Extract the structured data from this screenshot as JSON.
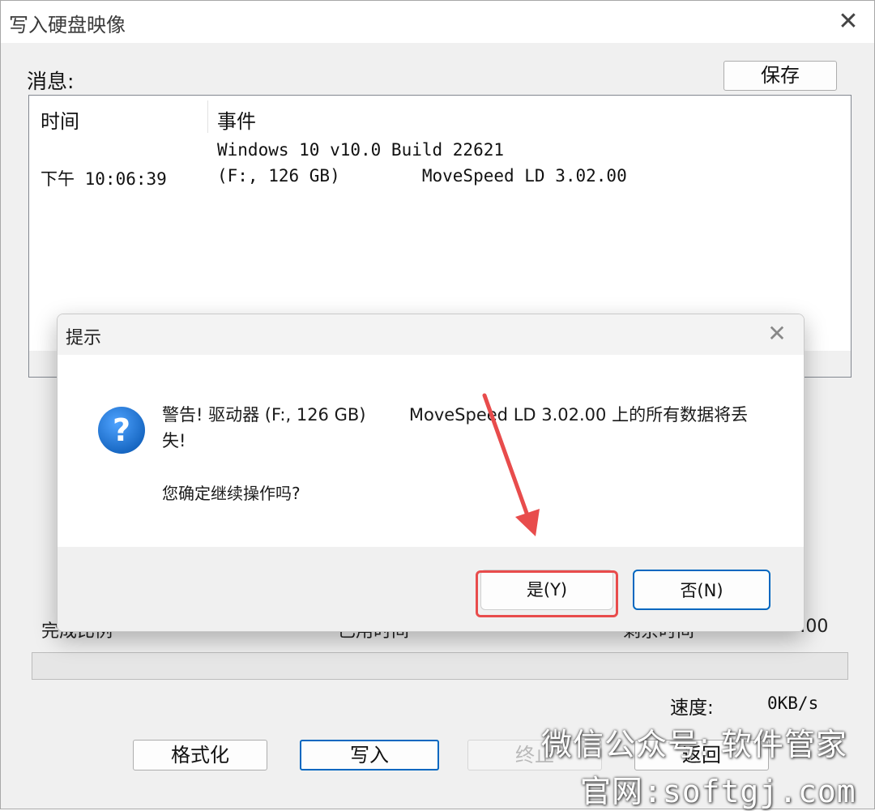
{
  "window": {
    "title": "写入硬盘映像",
    "close": "✕"
  },
  "messages": {
    "label": "消息:",
    "save_button": "保存",
    "columns": [
      "时间",
      "事件"
    ],
    "rows": [
      {
        "time": "",
        "event": "Windows 10 v10.0 Build 22621"
      },
      {
        "time": "下午 10:06:39",
        "event": "(F:, 126 GB)        MoveSpeed LD 3.02.00"
      }
    ]
  },
  "status": {
    "completed_label": "完成比例",
    "elapsed_label": "已用时间",
    "remaining_label": "剩余时间",
    "remaining_value": ":00",
    "progress": 0,
    "speed_label": "速度:",
    "speed_value": "0KB/s"
  },
  "buttons": {
    "format": "格式化",
    "write": "写入",
    "abort": "终止",
    "back": "返回"
  },
  "dialog": {
    "title": "提示",
    "close": "✕",
    "icon": "question-icon",
    "warning": "警告! 驱动器 (F:, 126 GB)        MoveSpeed LD 3.02.00 上的所有数据将丢\n失!",
    "confirm": "您确定继续操作吗?",
    "yes": "是(Y)",
    "no": "否(N)"
  },
  "watermark": {
    "line1": "微信公众号: 软件管家",
    "line2": "官网:softgj.com"
  },
  "colors": {
    "accent": "#0067c0",
    "highlight": "#e84c4c",
    "arrow": "#e84c4c"
  }
}
